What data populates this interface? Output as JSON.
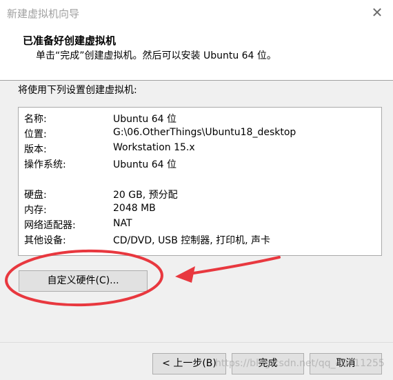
{
  "window": {
    "title": "新建虚拟机向导",
    "close_glyph": "✕"
  },
  "header": {
    "title": "已准备好创建虚拟机",
    "subtitle": "单击“完成”创建虚拟机。然后可以安装 Ubuntu 64 位。"
  },
  "intro": "将使用下列设置创建虚拟机:",
  "settings": [
    {
      "label": "名称:",
      "value": "Ubuntu 64 位"
    },
    {
      "label": "位置:",
      "value": "G:\\06.OtherThings\\Ubuntu18_desktop"
    },
    {
      "label": "版本:",
      "value": "Workstation 15.x"
    },
    {
      "label": "操作系统:",
      "value": "Ubuntu 64 位"
    },
    {
      "label": "硬盘:",
      "value": "20 GB, 预分配"
    },
    {
      "label": "内存:",
      "value": "2048 MB"
    },
    {
      "label": "网络适配器:",
      "value": "NAT"
    },
    {
      "label": "其他设备:",
      "value": "CD/DVD, USB 控制器, 打印机, 声卡"
    }
  ],
  "buttons": {
    "customize": "自定义硬件(C)...",
    "back": "< 上一步(B)",
    "finish": "完成",
    "cancel": "取消"
  },
  "watermark": "https://blog.csdn.net/qq_40411255",
  "colors": {
    "annotation": "#e8383f",
    "button_face": "#e1e1e1"
  }
}
